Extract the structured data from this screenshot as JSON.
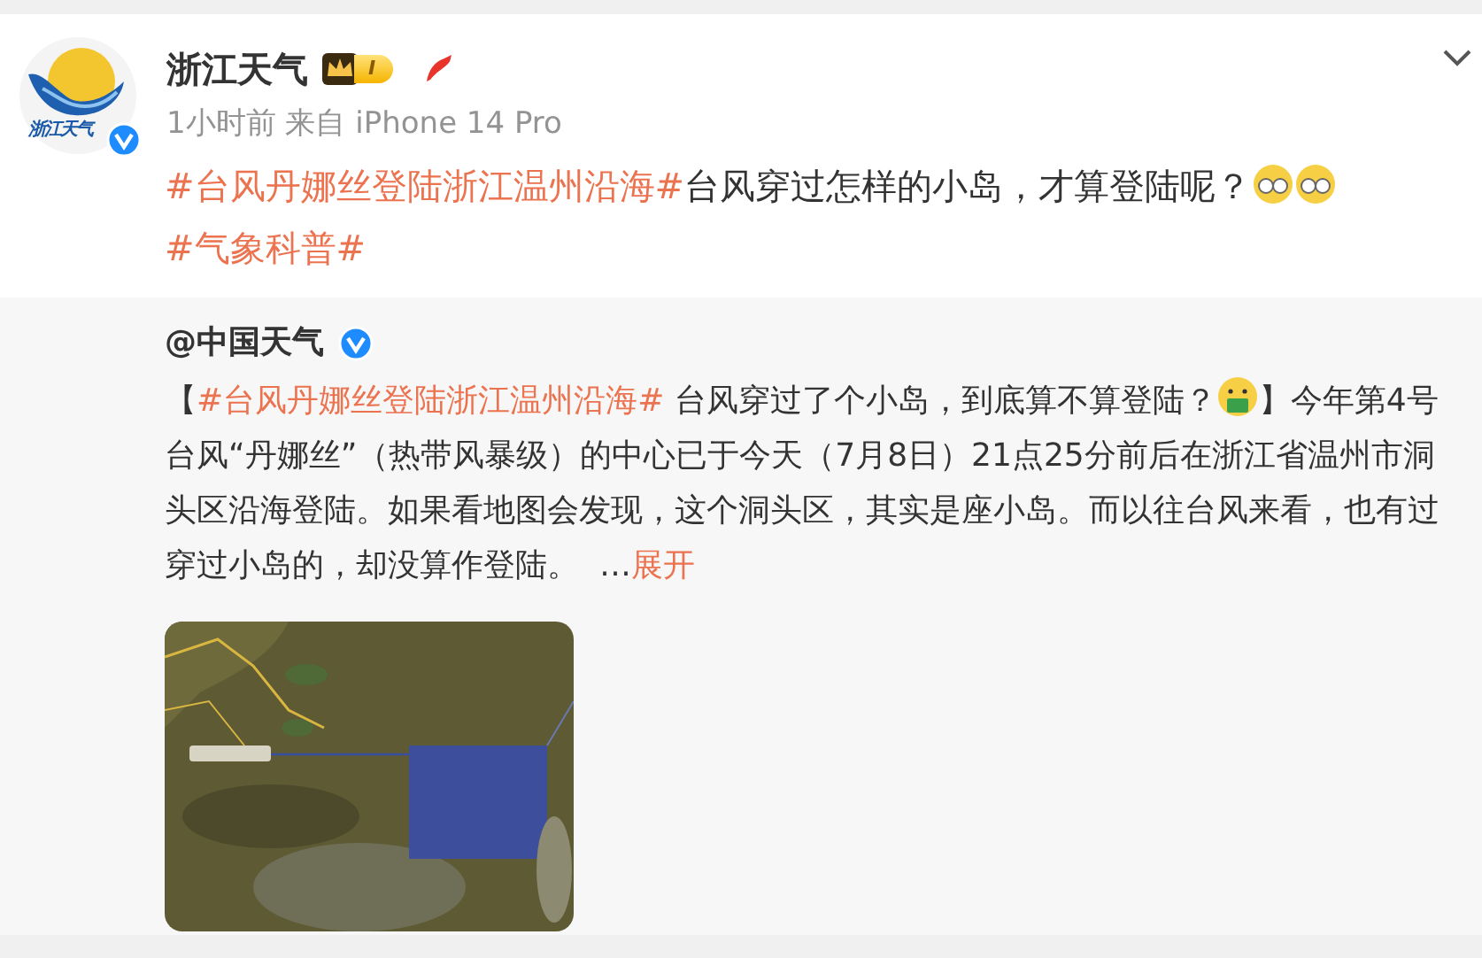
{
  "post": {
    "author": "浙江天气",
    "logo_text": "浙江天气",
    "verified": true,
    "level": "I",
    "time": "1小时前",
    "source": "来自 iPhone 14 Pro",
    "segments": [
      {
        "kind": "topic",
        "text": "#台风丹娜丝登陆浙江温州沿海#"
      },
      {
        "kind": "text",
        "text": "台风穿过怎样的小岛，才算登陆呢？"
      },
      {
        "kind": "emoji"
      },
      {
        "kind": "emoji"
      },
      {
        "kind": "topic",
        "text": "#气象科普#"
      }
    ]
  },
  "repost": {
    "author": "@中国天气",
    "verified": true,
    "segments": [
      {
        "kind": "text",
        "text": "【"
      },
      {
        "kind": "topic",
        "text": "#台风丹娜丝登陆浙江温州沿海#"
      },
      {
        "kind": "text",
        "text": " 台风穿过了个小岛，到底算不算登陆？"
      },
      {
        "kind": "emoji"
      },
      {
        "kind": "text",
        "text": "】今年第4号台风“丹娜丝”（热带风暴级）的中心已于今天（7月8日）21点25分前后在浙江省温州市洞头区沿海登陆。如果看地图会发现，这个洞头区，其实是座小岛。而以往台风来看，也有过穿过小岛的，却没算作登陆。"
      },
      {
        "kind": "text",
        "text": "  …"
      },
      {
        "kind": "more",
        "text": "展开"
      }
    ]
  }
}
